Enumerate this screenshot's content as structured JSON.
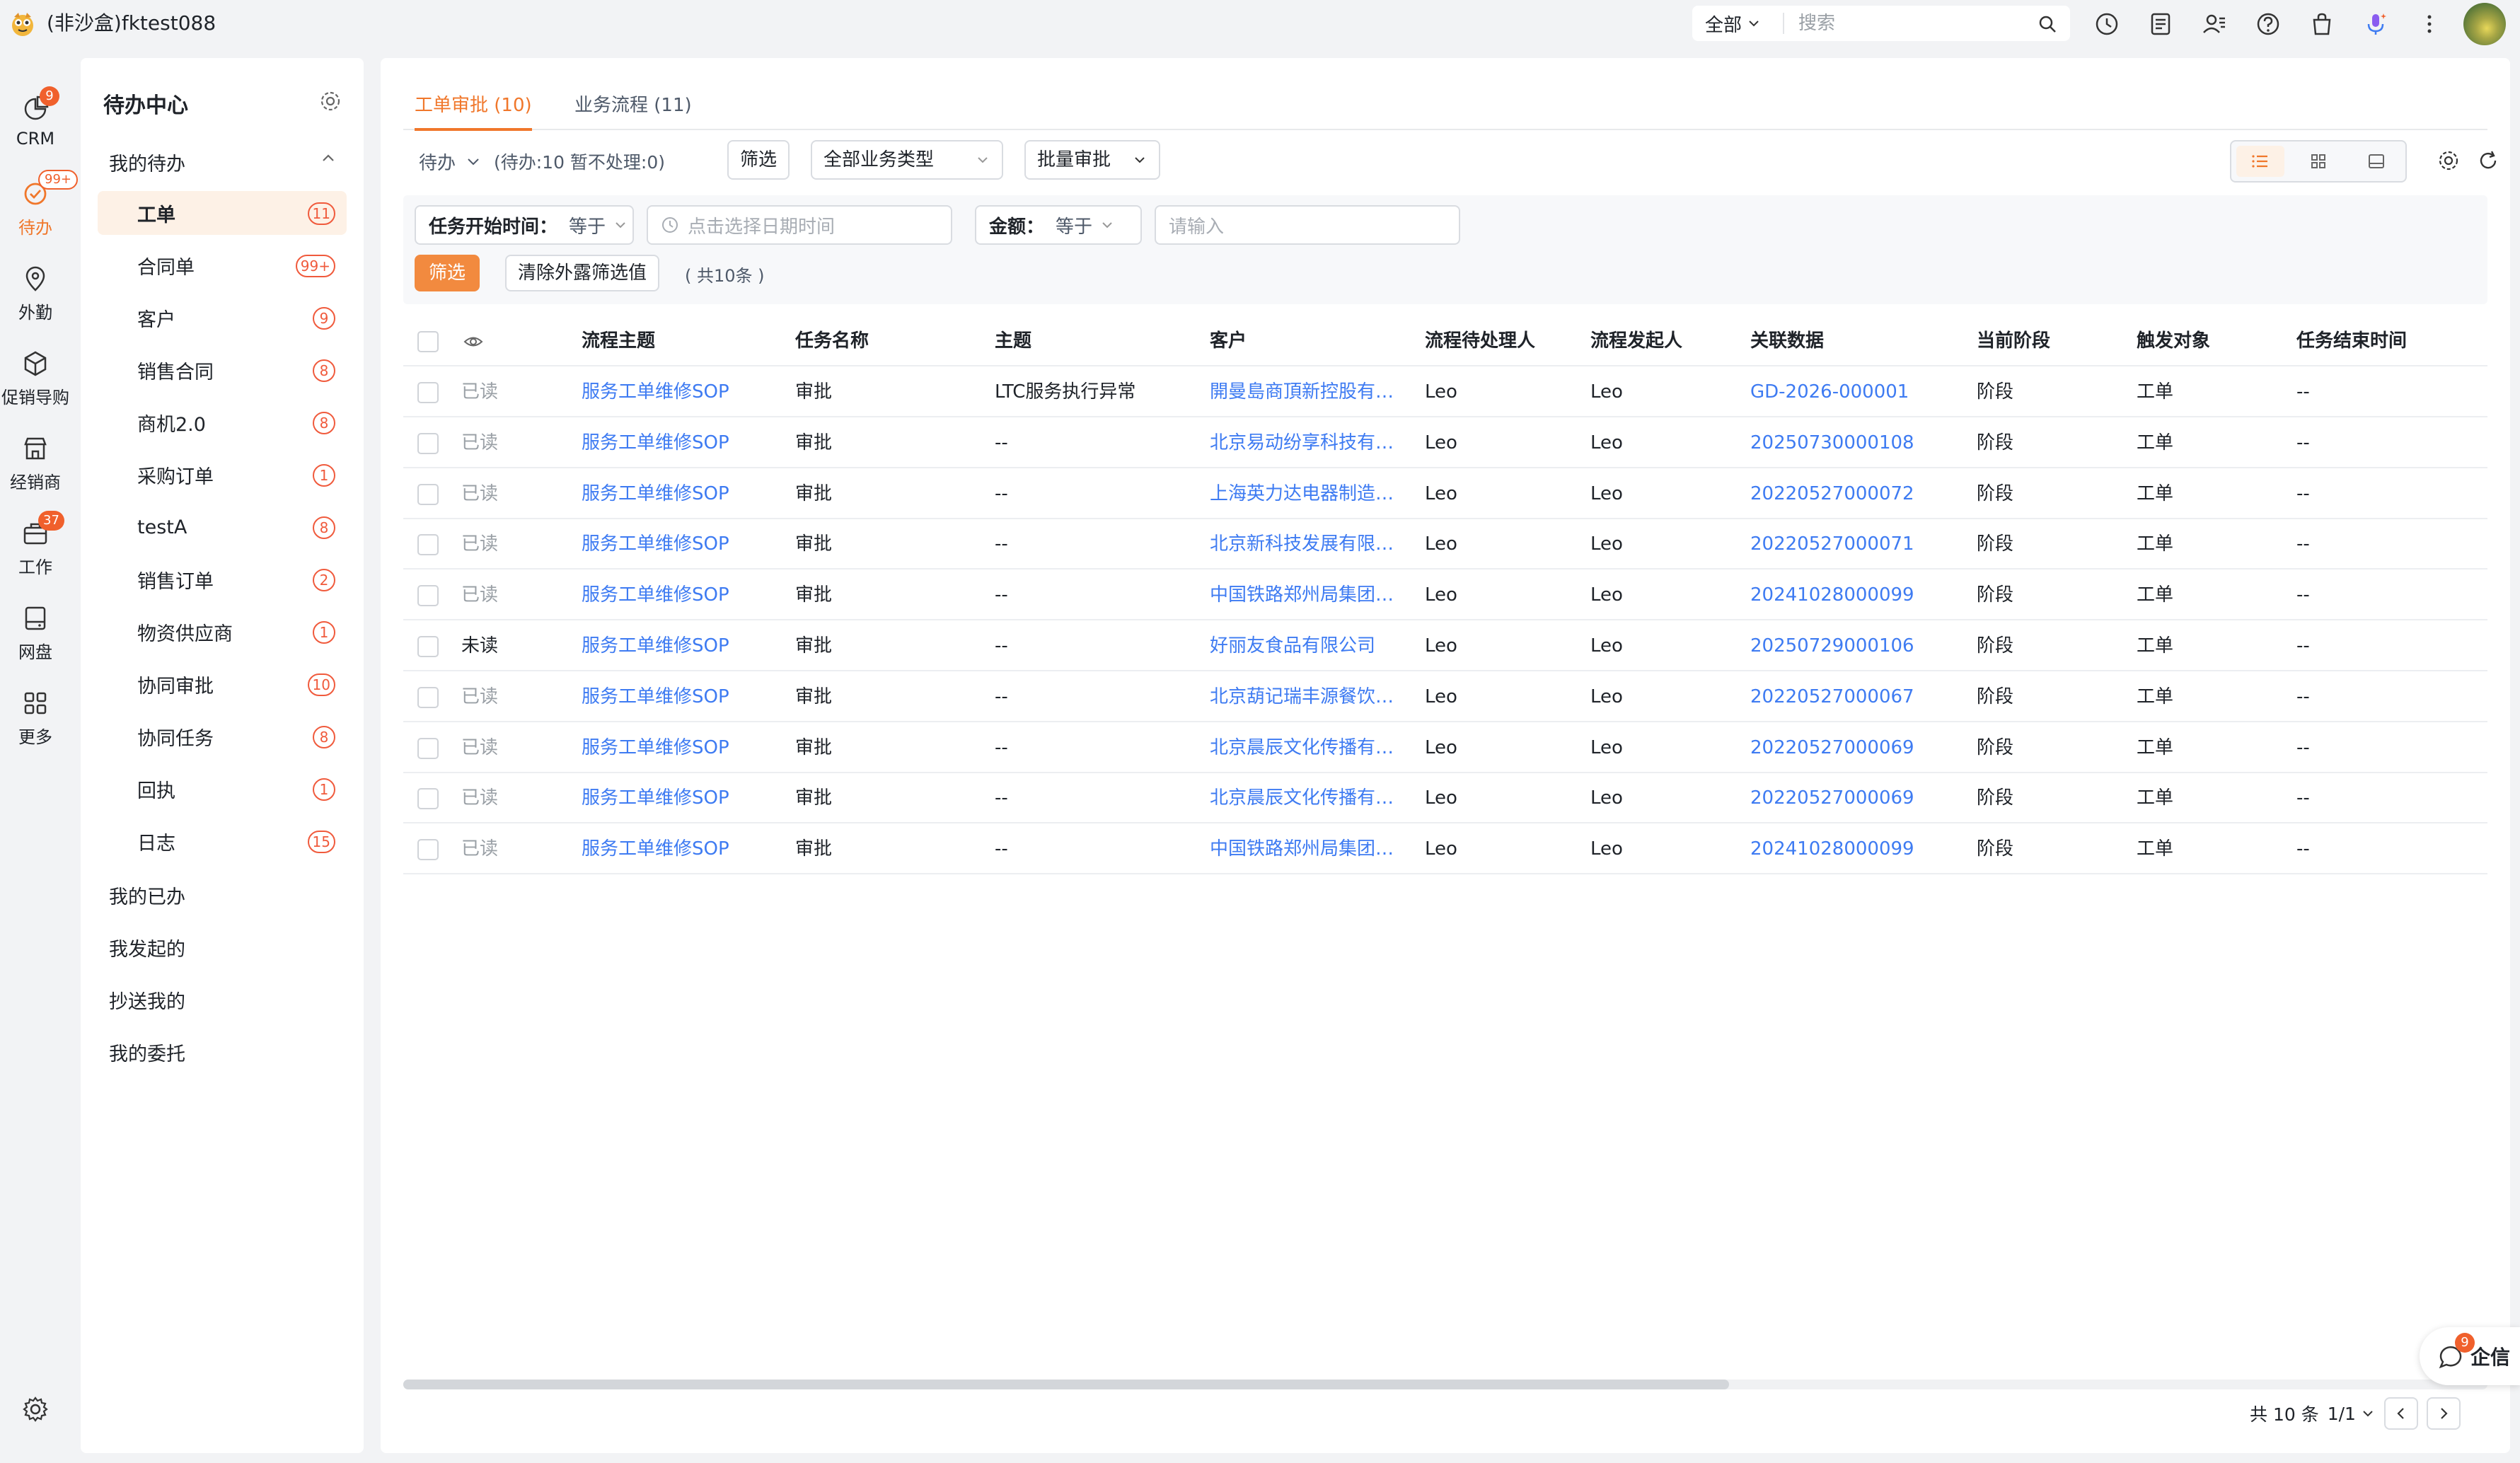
{
  "app": {
    "title": "(非沙盒)fktest088"
  },
  "search": {
    "scope": "全部",
    "placeholder": "搜索"
  },
  "rail": [
    {
      "label": "CRM",
      "badge": "9"
    },
    {
      "label": "待办",
      "badge": "99+"
    },
    {
      "label": "外勤",
      "badge": ""
    },
    {
      "label": "促销导购",
      "badge": ""
    },
    {
      "label": "经销商",
      "badge": ""
    },
    {
      "label": "工作",
      "badge": "37"
    },
    {
      "label": "网盘",
      "badge": ""
    },
    {
      "label": "更多",
      "badge": ""
    }
  ],
  "side": {
    "title": "待办中心",
    "group_mine": "我的待办",
    "items": [
      {
        "label": "工单",
        "badge": "11"
      },
      {
        "label": "合同单",
        "badge": "99+"
      },
      {
        "label": "客户",
        "badge": "9"
      },
      {
        "label": "销售合同",
        "badge": "8"
      },
      {
        "label": "商机2.0",
        "badge": "8"
      },
      {
        "label": "采购订单",
        "badge": "1"
      },
      {
        "label": "testA",
        "badge": "8"
      },
      {
        "label": "销售订单",
        "badge": "2"
      },
      {
        "label": "物资供应商",
        "badge": "1"
      },
      {
        "label": "协同审批",
        "badge": "10"
      },
      {
        "label": "协同任务",
        "badge": "8"
      },
      {
        "label": "回执",
        "badge": "1"
      },
      {
        "label": "日志",
        "badge": "15"
      }
    ],
    "groups": [
      "我的已办",
      "我发起的",
      "抄送我的",
      "我的委托"
    ]
  },
  "tabs": [
    {
      "label": "工单审批 (10)"
    },
    {
      "label": "业务流程 (11)"
    }
  ],
  "toolbar": {
    "pending": "待办",
    "count_text": "(待办:10 暂不处理:0)",
    "filter_btn": "筛选",
    "biz_type": "全部业务类型",
    "batch": "批量审批"
  },
  "filters": {
    "start_label": "任务开始时间：",
    "start_op": "等于",
    "date_placeholder": "点击选择日期时间",
    "amount_label": "金额：",
    "amount_op": "等于",
    "amount_placeholder": "请输入",
    "apply": "筛选",
    "clear": "清除外露筛选值",
    "total": "( 共10条 )"
  },
  "table": {
    "headers": [
      "流程主题",
      "任务名称",
      "主题",
      "客户",
      "流程待处理人",
      "流程发起人",
      "关联数据",
      "当前阶段",
      "触发对象",
      "任务结束时间"
    ],
    "rows": [
      {
        "read": "已读",
        "flow": "服务工单维修SOP",
        "task": "审批",
        "subject": "LTC服务执行异常",
        "customer": "開曼島商頂新控股有限公司",
        "handler": "Leo",
        "initiator": "Leo",
        "related": "GD-2026-000001",
        "stage": "阶段",
        "target": "工单",
        "end": "--"
      },
      {
        "read": "已读",
        "flow": "服务工单维修SOP",
        "task": "审批",
        "subject": "--",
        "customer": "北京易动纷享科技有限公司",
        "handler": "Leo",
        "initiator": "Leo",
        "related": "20250730000108",
        "stage": "阶段",
        "target": "工单",
        "end": "--"
      },
      {
        "read": "已读",
        "flow": "服务工单维修SOP",
        "task": "审批",
        "subject": "--",
        "customer": "上海英力达电器制造有限公司",
        "handler": "Leo",
        "initiator": "Leo",
        "related": "20220527000072",
        "stage": "阶段",
        "target": "工单",
        "end": "--"
      },
      {
        "read": "已读",
        "flow": "服务工单维修SOP",
        "task": "审批",
        "subject": "--",
        "customer": "北京新科技发展有限公司",
        "handler": "Leo",
        "initiator": "Leo",
        "related": "20220527000071",
        "stage": "阶段",
        "target": "工单",
        "end": "--"
      },
      {
        "read": "已读",
        "flow": "服务工单维修SOP",
        "task": "审批",
        "subject": "--",
        "customer": "中国铁路郑州局集团有限公司",
        "handler": "Leo",
        "initiator": "Leo",
        "related": "20241028000099",
        "stage": "阶段",
        "target": "工单",
        "end": "--"
      },
      {
        "read": "未读",
        "flow": "服务工单维修SOP",
        "task": "审批",
        "subject": "--",
        "customer": "好丽友食品有限公司",
        "handler": "Leo",
        "initiator": "Leo",
        "related": "20250729000106",
        "stage": "阶段",
        "target": "工单",
        "end": "--"
      },
      {
        "read": "已读",
        "flow": "服务工单维修SOP",
        "task": "审批",
        "subject": "--",
        "customer": "北京葫记瑞丰源餐饮有限公司",
        "handler": "Leo",
        "initiator": "Leo",
        "related": "20220527000067",
        "stage": "阶段",
        "target": "工单",
        "end": "--"
      },
      {
        "read": "已读",
        "flow": "服务工单维修SOP",
        "task": "审批",
        "subject": "--",
        "customer": "北京晨辰文化传播有限公司",
        "handler": "Leo",
        "initiator": "Leo",
        "related": "20220527000069",
        "stage": "阶段",
        "target": "工单",
        "end": "--"
      },
      {
        "read": "已读",
        "flow": "服务工单维修SOP",
        "task": "审批",
        "subject": "--",
        "customer": "北京晨辰文化传播有限公司",
        "handler": "Leo",
        "initiator": "Leo",
        "related": "20220527000069",
        "stage": "阶段",
        "target": "工单",
        "end": "--"
      },
      {
        "read": "已读",
        "flow": "服务工单维修SOP",
        "task": "审批",
        "subject": "--",
        "customer": "中国铁路郑州局集团有限公司",
        "handler": "Leo",
        "initiator": "Leo",
        "related": "20241028000099",
        "stage": "阶段",
        "target": "工单",
        "end": "--"
      }
    ]
  },
  "pager": {
    "total": "共 10 条",
    "page": "1/1"
  },
  "qixin": {
    "label": "企信",
    "badge": "9"
  },
  "colors": {
    "accent": "#f0772b",
    "link": "#3e7bf2",
    "badge": "#f05a3c"
  }
}
